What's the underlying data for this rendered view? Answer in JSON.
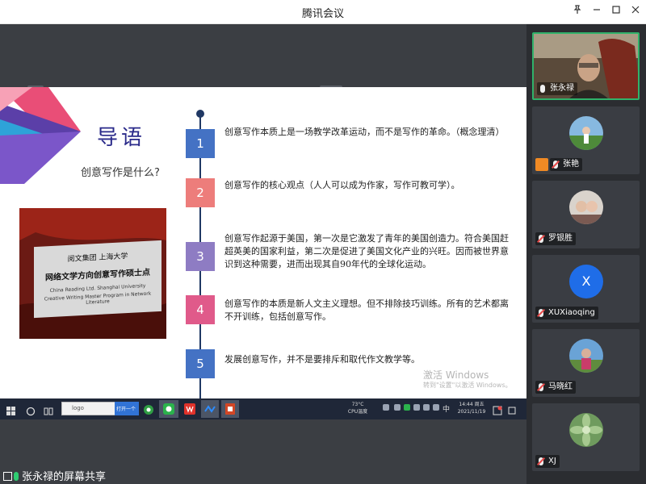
{
  "window": {
    "title": "腾讯会议",
    "pin_icon": "pin-icon",
    "minimize_icon": "minimize-icon",
    "maximize_icon": "maximize-icon",
    "close_icon": "close-icon"
  },
  "slide": {
    "title": "导语",
    "subtitle": "创意写作是什么?",
    "photo_text": {
      "line1": "阅文集团  上海大学",
      "line2": "网络文学方向创意写作硕士点",
      "line3": "China Reading Ltd.   Shanghai University",
      "line4": "Creative Writing Master Program in Network Literature"
    },
    "items": [
      {
        "num": "1",
        "text": "创意写作本质上是一场教学改革运动，而不是写作的革命。（概念理清）",
        "color": "#4472c4"
      },
      {
        "num": "2",
        "text": "创意写作的核心观点（人人可以成为作家，写作可教可学）。",
        "color": "#ed7d7b"
      },
      {
        "num": "3",
        "text": "创意写作起源于美国，第一次是它激发了青年的美国创造力。符合美国赶超英美的国家利益，第二次是促进了美国文化产业的兴旺。因而被世界意识到这种需要，进而出现其自90年代的全球化运动。",
        "color": "#8e7cc3"
      },
      {
        "num": "4",
        "text": "创意写作的本质是新人文主义理想。但不排除技巧训练。所有的艺术都离不开训练，包括创意写作。",
        "color": "#e05a8a"
      },
      {
        "num": "5",
        "text": "发展创意写作，并不是要排斥和取代作文教学等。",
        "color": "#4472c4"
      }
    ],
    "watermark_line1": "激活 Windows",
    "watermark_line2": "转到\"设置\"以激活 Windows。"
  },
  "taskbar": {
    "search_text": "logo",
    "blue_tab_text": "打开一个",
    "temp_line1": "73°C",
    "temp_line2": "CPU温度",
    "clock_time": "14:44 周五",
    "clock_date": "2021/11/19",
    "ime_text": "中"
  },
  "share_status": {
    "text": "张永禄的屏幕共享"
  },
  "participants": [
    {
      "name": "张永禄",
      "muted": false,
      "kind": "camera"
    },
    {
      "name": "张艳",
      "muted": true,
      "kind": "photo"
    },
    {
      "name": "罗银胜",
      "muted": true,
      "kind": "photo"
    },
    {
      "name": "XUXiaoqing",
      "muted": true,
      "kind": "letter",
      "letter": "X"
    },
    {
      "name": "马晓红",
      "muted": true,
      "kind": "photo"
    },
    {
      "name": "XJ",
      "muted": true,
      "kind": "photo"
    }
  ]
}
